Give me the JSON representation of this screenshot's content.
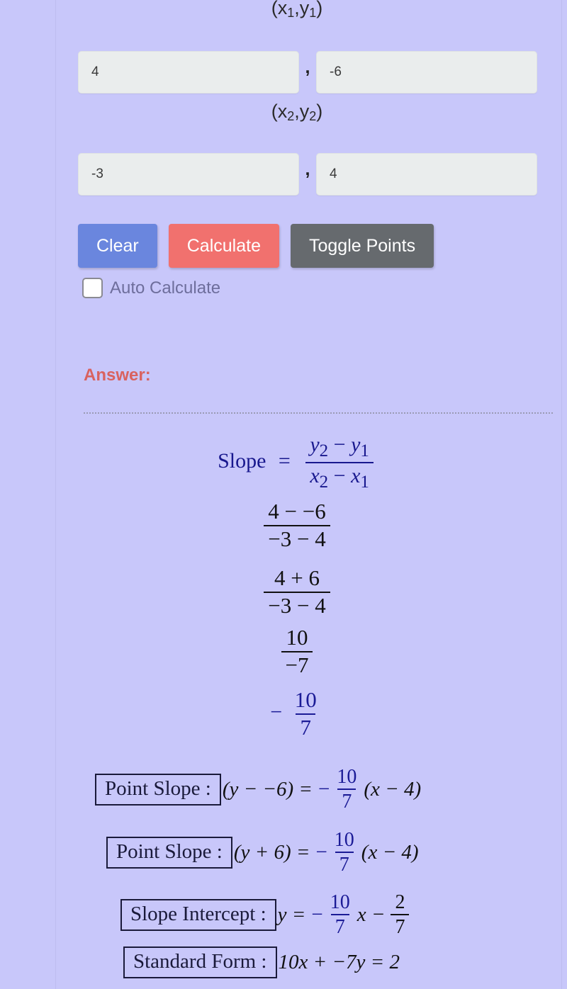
{
  "labels": {
    "point1": "(x",
    "point1_sub1": "1",
    "point1_mid": ",y",
    "point1_sub2": "1",
    "point1_end": ")",
    "point2": "(x",
    "point2_sub1": "2",
    "point2_mid": ",y",
    "point2_sub2": "2",
    "point2_end": ")",
    "comma": ","
  },
  "inputs": {
    "x1": "4",
    "y1": "-6",
    "x2": "-3",
    "y2": "4"
  },
  "buttons": {
    "clear": "Clear",
    "calculate": "Calculate",
    "toggle_points": "Toggle Points"
  },
  "checkbox": {
    "label": "Auto Calculate",
    "checked": false
  },
  "answer": {
    "title": "Answer:"
  },
  "colors": {
    "background": "#c8c7fa",
    "clear_button": "#6a86de",
    "calculate_button": "#f1716e",
    "toggle_button": "#666a6e",
    "answer_label": "#d9625f",
    "math_blue": "#1b1b96",
    "input_background": "#eaeded"
  },
  "math": {
    "slope_word": "Slope",
    "equals": "=",
    "formula_num_y2": "y",
    "formula_num_sub2": "2",
    "formula_minus": "−",
    "formula_num_y1": "y",
    "formula_num_sub1": "1",
    "formula_den_x2": "x",
    "formula_den_sub2": "2",
    "formula_den_x1": "x",
    "formula_den_sub1": "1",
    "step1_num": "4 − −6",
    "step1_den": "−3 − 4",
    "step2_num": "4 + 6",
    "step2_den": "−3 − 4",
    "step3_num": "10",
    "step3_den": "−7",
    "step4_sign": "−",
    "step4_num": "10",
    "step4_den": "7"
  },
  "results": [
    {
      "label": "Point Slope :",
      "lhs": "(y − −6) =",
      "sign": "−",
      "frac_num": "10",
      "frac_den": "7",
      "tail": "(x − 4)",
      "tail2": ""
    },
    {
      "label": "Point Slope :",
      "lhs": "(y + 6) =",
      "sign": "−",
      "frac_num": "10",
      "frac_den": "7",
      "tail": "(x − 4)",
      "tail2": ""
    },
    {
      "label": "Slope Intercept :",
      "lhs": "y =",
      "sign": "−",
      "frac_num": "10",
      "frac_den": "7",
      "tail": "x −",
      "tail2_num": "2",
      "tail2_den": "7"
    },
    {
      "label": "Standard Form :",
      "equation": "10x + −7y = 2"
    }
  ]
}
